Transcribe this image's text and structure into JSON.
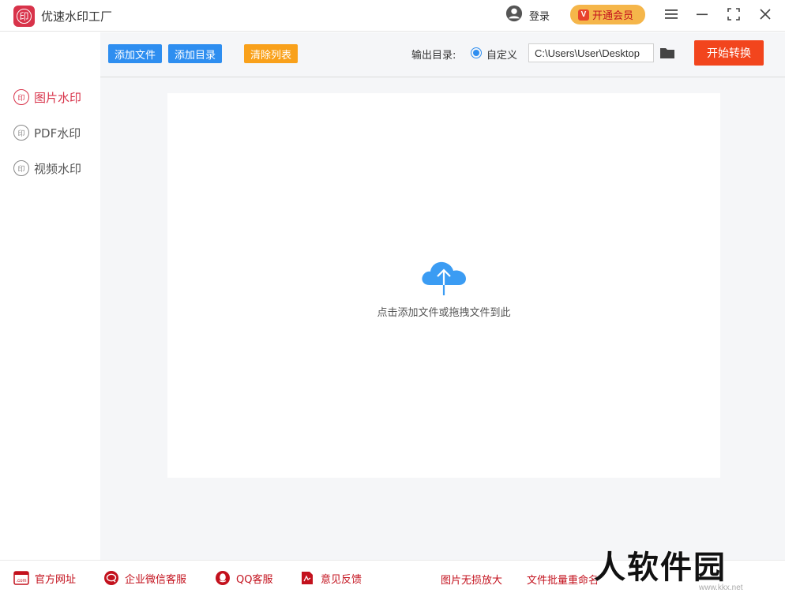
{
  "app": {
    "title": "优速水印工厂",
    "logo_text": "印",
    "login_label": "登录",
    "vip_label": "开通会员",
    "vip_icon_text": "V"
  },
  "sidebar": {
    "seal_text": "印",
    "items": [
      {
        "label": "图片水印",
        "active": true
      },
      {
        "label": "PDF水印",
        "active": false
      },
      {
        "label": "视频水印",
        "active": false
      }
    ]
  },
  "toolbar": {
    "add_file_label": "添加文件",
    "add_dir_label": "添加目录",
    "clear_list_label": "清除列表",
    "output_dir_label": "输出目录:",
    "custom_label": "自定义",
    "output_path": "C:\\Users\\User\\Desktop",
    "start_label": "开始转换"
  },
  "main": {
    "drop_hint": "点击添加文件或拖拽文件到此"
  },
  "footer": {
    "items": [
      {
        "label": "官方网址",
        "icon": "website-icon"
      },
      {
        "label": "企业微信客服",
        "icon": "wechat-work-icon"
      },
      {
        "label": "QQ客服",
        "icon": "qq-icon"
      },
      {
        "label": "意见反馈",
        "icon": "feedback-icon"
      }
    ],
    "links": [
      "图片无损放大",
      "文件批量重命名"
    ],
    "website_icon_text": ".com"
  },
  "watermark": {
    "text": "人软件园",
    "url": "www.kkx.net"
  },
  "colors": {
    "brand_red": "#d8334a",
    "primary_blue": "#2e8ef0",
    "clear_orange": "#f9a11b",
    "start_red": "#f2451d",
    "vip_gold": "#f5b64a",
    "footer_red": "#c3111d"
  }
}
